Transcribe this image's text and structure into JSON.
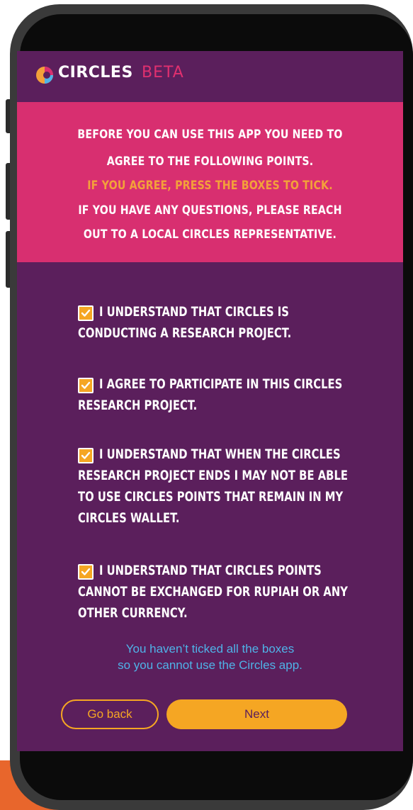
{
  "header": {
    "brand": "CIRCLES",
    "beta": "BETA"
  },
  "notice": {
    "lines": [
      "BEFORE YOU CAN USE THIS APP YOU NEED TO",
      "AGREE TO THE FOLLOWING POINTS.",
      "IF YOU AGREE, PRESS THE BOXES TO TICK.",
      "IF YOU HAVE ANY QUESTIONS, PLEASE REACH",
      "OUT TO A LOCAL CIRCLES REPRESENTATIVE."
    ]
  },
  "agreements": [
    {
      "checked": true,
      "lines": [
        "I UNDERSTAND THAT CIRCLES IS",
        "CONDUCTING A RESEARCH PROJECT."
      ]
    },
    {
      "checked": true,
      "lines": [
        "I AGREE TO PARTICIPATE IN THIS CIRCLES",
        "RESEARCH PROJECT."
      ]
    },
    {
      "checked": true,
      "lines": [
        "I UNDERSTAND THAT WHEN THE CIRCLES",
        "RESEARCH PROJECT ENDS I MAY NOT BE ABLE",
        "TO USE CIRCLES POINTS THAT REMAIN IN MY",
        "CIRCLES WALLET."
      ]
    },
    {
      "checked": true,
      "lines": [
        "I UNDERSTAND THAT CIRCLES POINTS",
        "CANNOT BE EXCHANGED FOR RUPIAH OR ANY",
        "OTHER CURRENCY."
      ]
    }
  ],
  "warning": {
    "lines": [
      "You haven’t ticked all the boxes",
      "so you cannot use the Circles app."
    ]
  },
  "buttons": {
    "back": "Go back",
    "next": "Next"
  },
  "colors": {
    "background": "#5b1f5c",
    "notice": "#d82f70",
    "accent": "#f5a623",
    "warning": "#4fb3e8",
    "beta": "#e0306f"
  }
}
